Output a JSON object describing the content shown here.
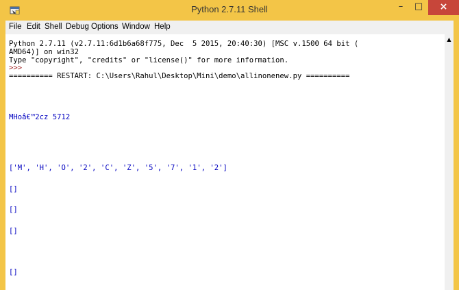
{
  "window": {
    "title": "Python 2.7.11 Shell"
  },
  "controls": {
    "minimize": "–",
    "maximize": "□",
    "close": "×"
  },
  "menu": [
    "File",
    "Edit",
    "Shell",
    "Debug",
    "Options",
    "Window",
    "Help"
  ],
  "colors": {
    "titlebar": "#f3c547",
    "close_button": "#c7463a",
    "prompt": "#a52a2a",
    "stdout": "#0000c0"
  },
  "shell": {
    "banner1": "Python 2.7.11 (v2.7.11:6d1b6a68f775, Dec  5 2015, 20:40:30) [MSC v.1500 64 bit (",
    "banner2": "AMD64)] on win32",
    "banner3": "Type \"copyright\", \"credits\" or \"license()\" for more information.",
    "prompt": ">>> ",
    "restart": "========== RESTART: C:\\Users\\Rahul\\Desktop\\Mini\\demo\\allinonenew.py ==========",
    "out1": "MHoâ€™2cz 5712",
    "out2": "['M', 'H', 'O', '2', 'C', 'Z', '5', '7', '1', '2']",
    "out3": "[]",
    "out4": "[]",
    "out5": "[]",
    "out6": "[]"
  }
}
